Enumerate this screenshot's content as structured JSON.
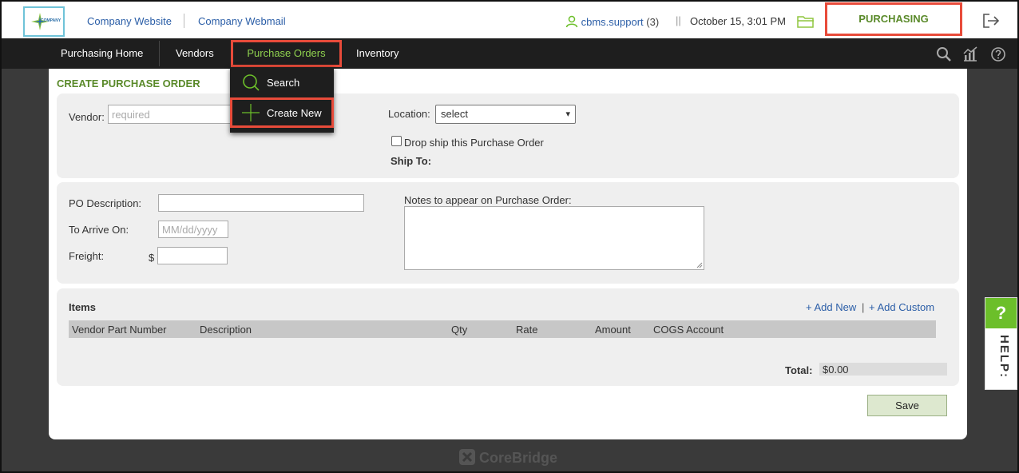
{
  "header": {
    "website_link": "Company Website",
    "webmail_link": "Company Webmail",
    "user": "cbms.support",
    "user_count": "(3)",
    "separator": "||",
    "datetime": "October 15, 3:01 PM",
    "module": "PURCHASING",
    "logo_text": "COMPANY"
  },
  "nav": {
    "items": [
      {
        "label": "Purchasing Home"
      },
      {
        "label": "Vendors"
      },
      {
        "label": "Purchase Orders"
      },
      {
        "label": "Inventory"
      }
    ],
    "active_color": "#8fd14f"
  },
  "dropdown": {
    "items": [
      {
        "label": "Search",
        "icon": "search-icon"
      },
      {
        "label": "Create New",
        "icon": "plus-icon"
      }
    ]
  },
  "page": {
    "title": "CREATE PURCHASE ORDER",
    "vendor_label": "Vendor:",
    "vendor_placeholder": "required",
    "location_label": "Location:",
    "location_value": "select",
    "dropship_label": "Drop ship this Purchase Order",
    "ship_to_label": "Ship To:",
    "po_description_label": "PO Description:",
    "arrive_label": "To Arrive On:",
    "arrive_placeholder": "MM/dd/yyyy",
    "freight_label": "Freight:",
    "currency": "$",
    "notes_label": "Notes to appear on Purchase Order:",
    "items_label": "Items",
    "add_new": "+ Add New",
    "link_sep": "|",
    "add_custom": "+ Add Custom",
    "columns": [
      "Vendor Part Number",
      "Description",
      "Qty",
      "Rate",
      "Amount",
      "COGS Account"
    ],
    "total_label": "Total:",
    "total_value": "$0.00",
    "save_label": "Save"
  },
  "help": {
    "q": "?",
    "word": "HELP:"
  },
  "brand": "CoreBridge",
  "colors": {
    "accent_green": "#5a8a2a",
    "highlight_red": "#e84b3a",
    "help_green": "#6cbf2a"
  }
}
